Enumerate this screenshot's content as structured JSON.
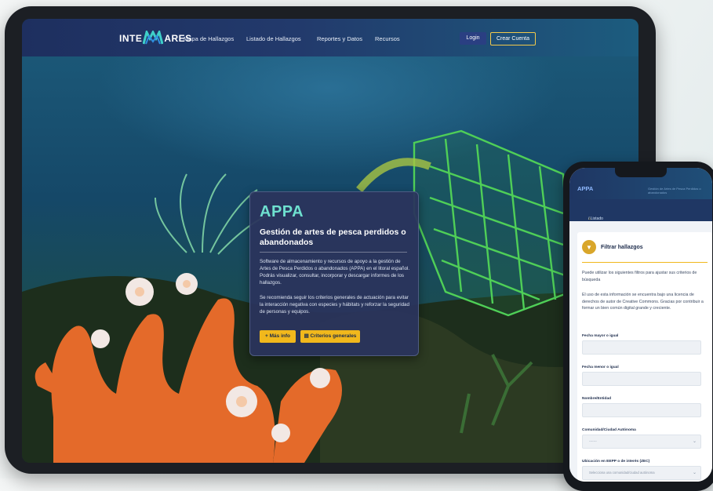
{
  "tablet": {
    "header": {
      "logo_left": "INTE",
      "logo_right": "ARES",
      "nav": [
        "Mapa de Hallazgos",
        "Listado de Hallazgos",
        "Reportes y Datos",
        "Recursos"
      ],
      "login": "Login",
      "signup": "Crear Cuenta"
    },
    "hero": {
      "title": "APPA",
      "subtitle": "Gestión de artes de pesca perdidos o abandonados",
      "paragraph1": "Software de almacenamiento y recursos de apoyo a la gestión de Artes de Pesca Perdidos o abandonados (APPA) en el litoral español. Podrás visualizar, consultar, incorporar y descargar informes de los hallazgos.",
      "paragraph2": "Se recomienda seguir los criterios generales de actuación para evitar la interacción negativa con especies y hábitats y reforzar la seguridad de personas y equipos.",
      "more_info": "+ Más info",
      "criteria": "Criterios generales"
    }
  },
  "phone": {
    "brand": "APPA",
    "top_right": "Gestión de Artes de Pesca Perdidos o abandonados",
    "breadcrumb": "/ Listado de Hallazgos",
    "filter": {
      "title": "Filtrar hallazgos",
      "intro": "Puede utilizar los siguientes filtros para ajustar sus criterios de búsqueda",
      "license": "El uso de esta información se encuentra bajo una licencia de derechos de autor de Creative Commons. Gracias por contribuir a formar un bien común digital grande y creciente.",
      "fields": {
        "date_from": "Fecha mayor o igual",
        "date_to": "Fecha menor o igual",
        "name": "Nombre/Entidad",
        "community": "Comunidad/Ciudad Autónoma",
        "community_value": "-------",
        "location": "Ubicación en EEPP o de interés (ZEC)",
        "location_placeholder": "Selecciona una comunidad/ciudad autónoma"
      }
    }
  }
}
